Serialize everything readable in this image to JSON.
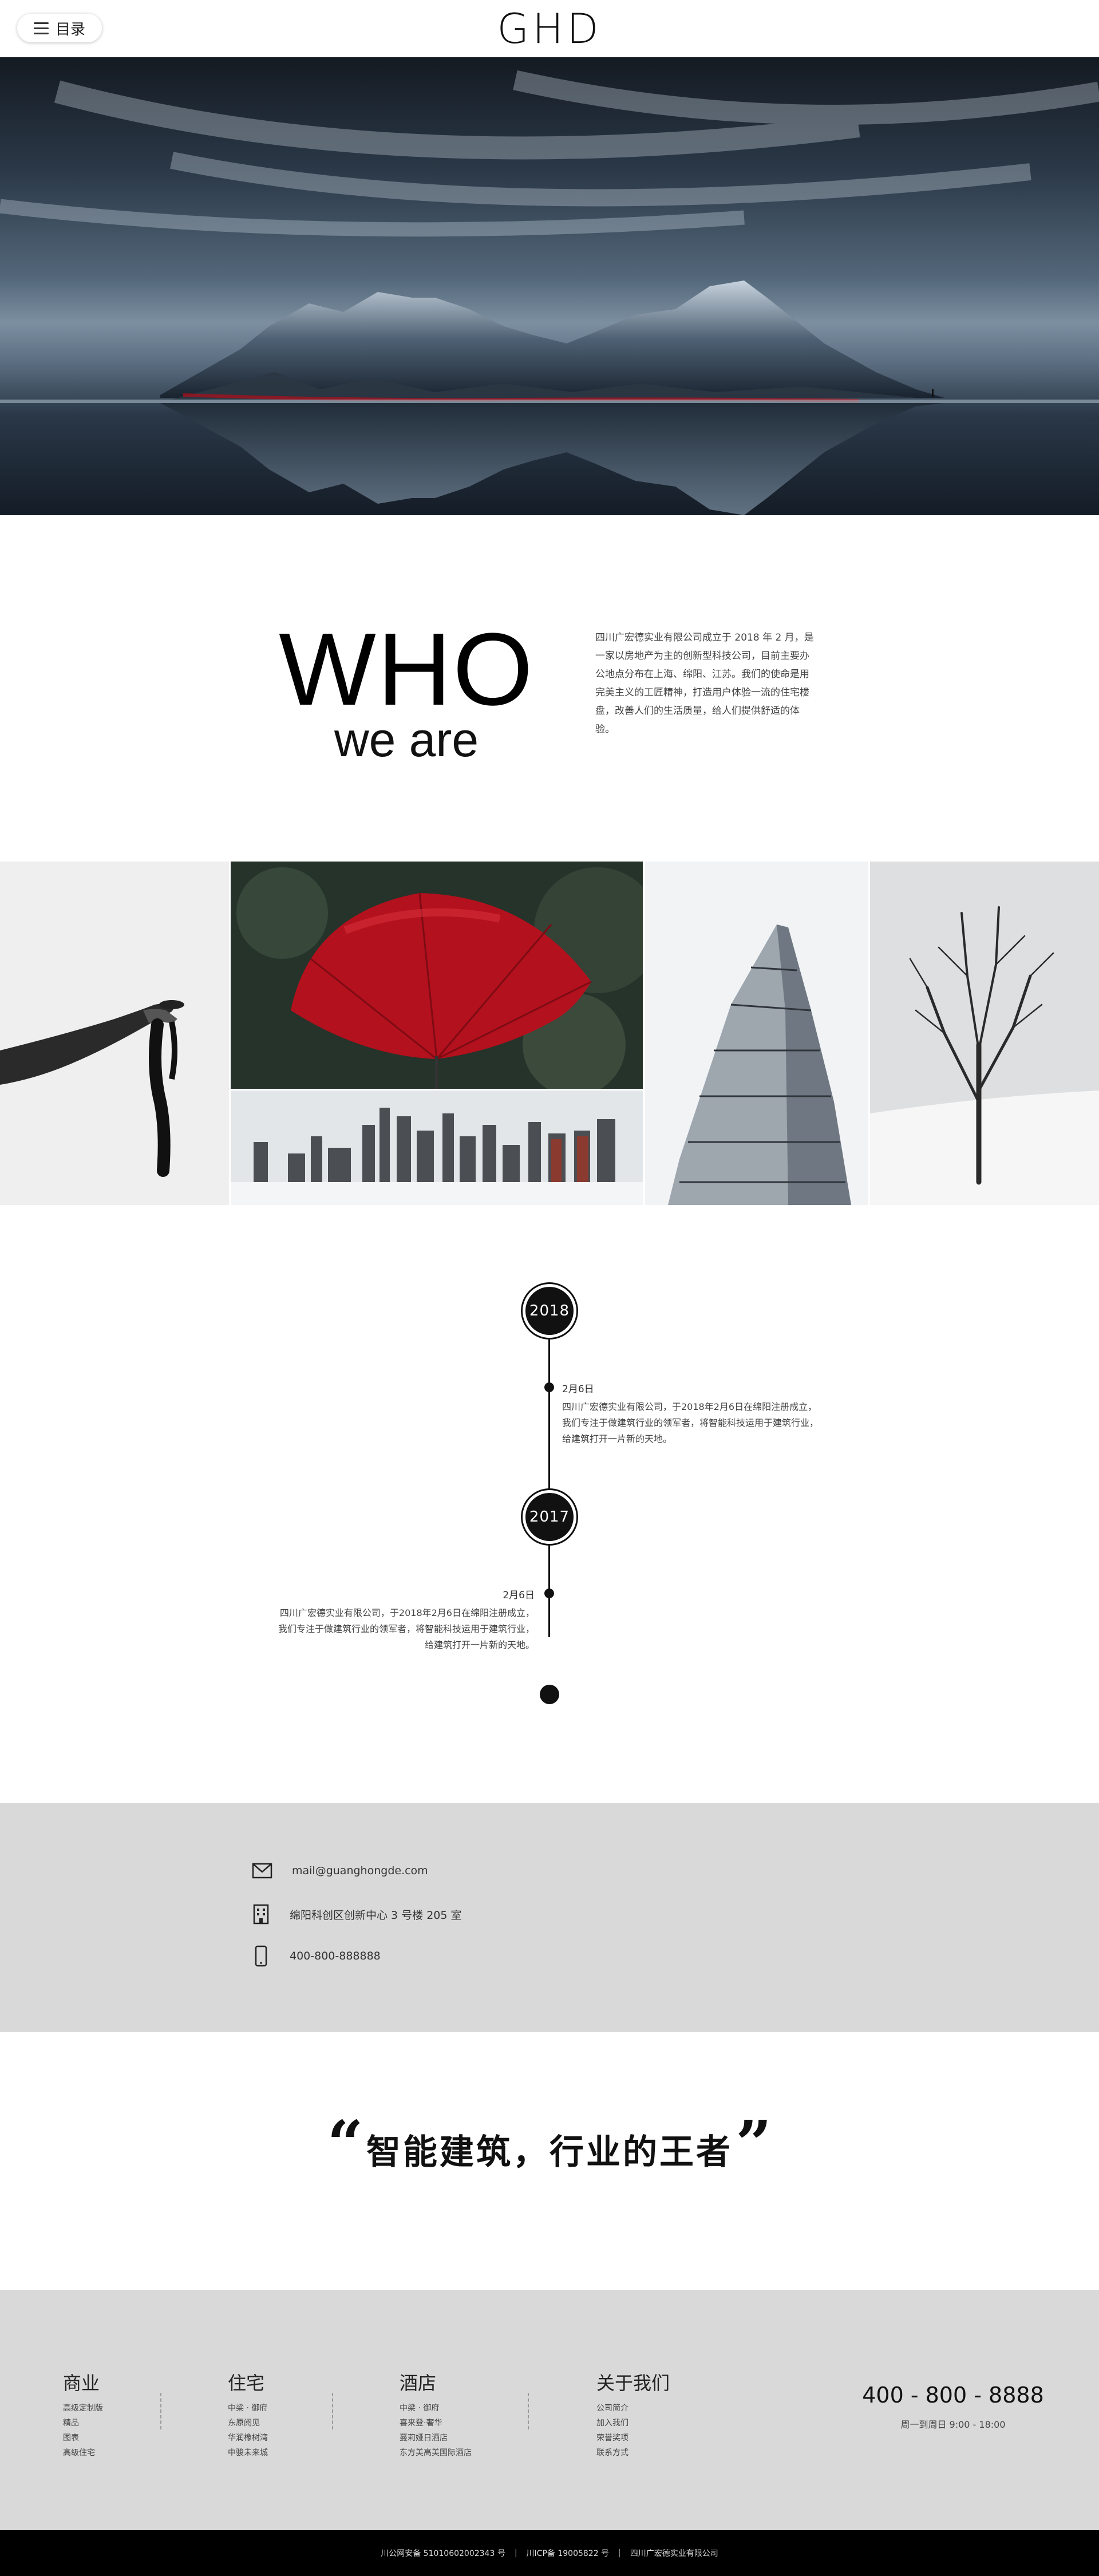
{
  "header": {
    "menu_label": "目录",
    "logo": "GHD"
  },
  "who": {
    "title_big": "WHO",
    "title_small": "we are",
    "description": "四川广宏德实业有限公司成立于 2018 年 2 月，是一家以房地产为主的创新型科技公司，目前主要办公地点分布在上海、绵阳、江苏。我们的使命是用完美主义的工匠精神，打造用户体验一流的住宅楼盘，改善人们的生活质量，给人们提供舒适的体验。"
  },
  "timeline": [
    {
      "year": "2018",
      "date": "2月6日",
      "text": "四川广宏德实业有限公司，于2018年2月6日在绵阳注册成立，我们专注于做建筑行业的领军者，将智能科技运用于建筑行业，给建筑打开一片新的天地。",
      "side": "right"
    },
    {
      "year": "2017",
      "date": "2月6日",
      "text": "四川广宏德实业有限公司，于2018年2月6日在绵阳注册成立，我们专注于做建筑行业的领军者，将智能科技运用于建筑行业，给建筑打开一片新的天地。",
      "side": "left"
    }
  ],
  "contact": {
    "email": "mail@guanghongde.com",
    "address": "绵阳科创区创新中心 3 号楼 205 室",
    "phone": "400-800-888888",
    "icons": [
      "mail-icon",
      "building-icon",
      "mobile-icon"
    ]
  },
  "slogan": {
    "open_quote": "“",
    "text": "智能建筑，行业的王者",
    "close_quote": "”"
  },
  "footer": {
    "columns": [
      {
        "title": "商业",
        "items": [
          "高级定制版",
          "精品",
          "图表",
          "高级住宅"
        ]
      },
      {
        "title": "住宅",
        "items": [
          "中梁 · 御府",
          "东原阅见",
          "华润橡树湾",
          "中骏未来城"
        ]
      },
      {
        "title": "酒店",
        "items": [
          "中梁 · 御府",
          "喜来登·奢华",
          "蔓莉娅日酒店",
          "东方美高美国际酒店"
        ]
      },
      {
        "title": "关于我们",
        "items": [
          "公司简介",
          "加入我们",
          "荣誉奖项",
          "联系方式"
        ]
      }
    ],
    "phone": "400 - 800 - 8888",
    "hours": "周一到周日 9:00 - 18:00"
  },
  "copyright": {
    "items": [
      "川公网安备 51010602002343 号",
      "川ICP备 19005822 号",
      "四川广宏德实业有限公司"
    ]
  },
  "colors": {
    "contact_bg": "#d9d9d9",
    "footer_bg": "#d9d9d9",
    "copyright_bg": "#000000",
    "accent_red": "#a8101c"
  }
}
